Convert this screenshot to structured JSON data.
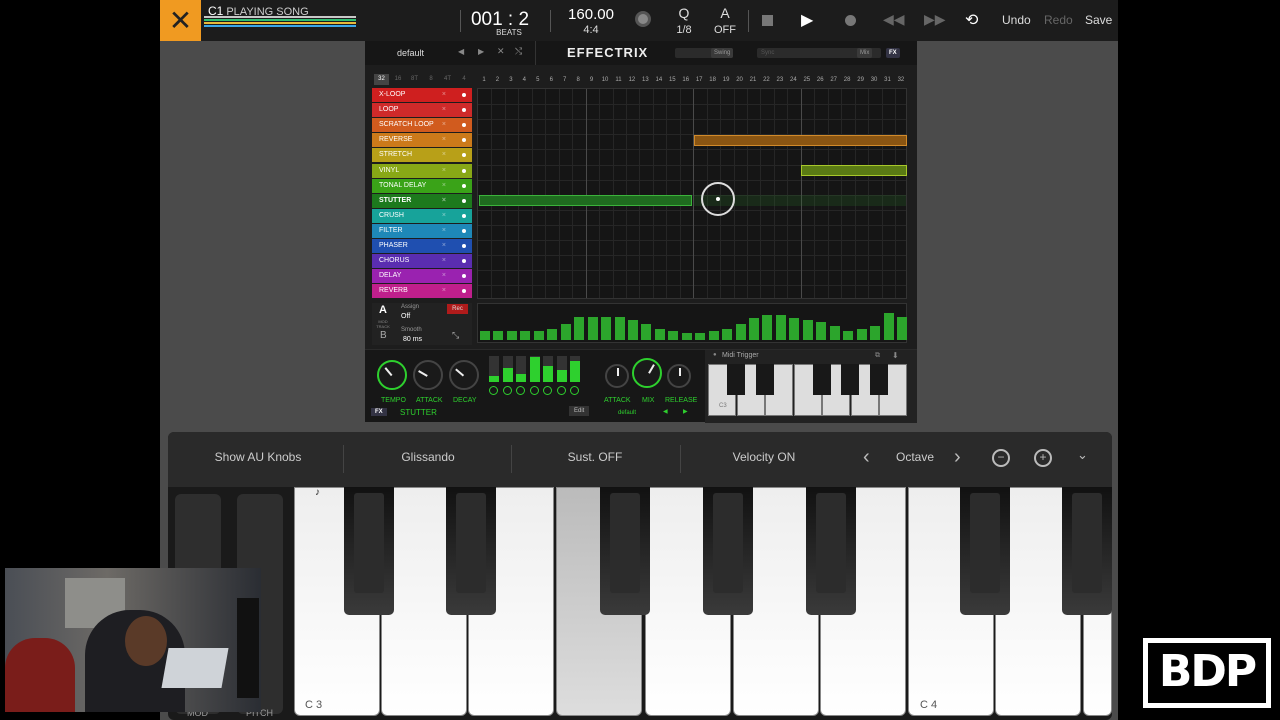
{
  "topbar": {
    "close_icon": "close-icon",
    "track_name": "C1",
    "song_status": "PLAYING SONG",
    "position": "001 : 2",
    "position_unit": "BEATS",
    "tempo": "160.00",
    "time_signature": "4:4",
    "quantize_label": "Q",
    "quantize_value": "1/8",
    "automation_label": "A",
    "automation_value": "OFF",
    "undo_label": "Undo",
    "redo_label": "Redo",
    "save_label": "Save",
    "track_colors": [
      "#c8c8c8",
      "#2fbf72",
      "#e8b93a",
      "#3aa6e8"
    ]
  },
  "plugin": {
    "preset": "default",
    "title": "EFFECTRIX",
    "swing_label": "Swing",
    "sync_label": "Sync",
    "mix_label": "Mix",
    "fx_label": "FX",
    "step_sizes": [
      "32",
      "16",
      "8T",
      "8",
      "4T",
      "4"
    ],
    "effects": [
      {
        "name": "X-LOOP",
        "color": "#cf1f1f"
      },
      {
        "name": "LOOP",
        "color": "#cf2a2a"
      },
      {
        "name": "SCRATCH LOOP",
        "color": "#d15b1e"
      },
      {
        "name": "REVERSE",
        "color": "#cc7a1a"
      },
      {
        "name": "STRETCH",
        "color": "#b8a018"
      },
      {
        "name": "VINYL",
        "color": "#88a816"
      },
      {
        "name": "TONAL DELAY",
        "color": "#3aa318"
      },
      {
        "name": "STUTTER",
        "color": "#1d7a1d"
      },
      {
        "name": "CRUSH",
        "color": "#17a39a"
      },
      {
        "name": "FILTER",
        "color": "#1e88b8"
      },
      {
        "name": "PHASER",
        "color": "#1f4fb0"
      },
      {
        "name": "CHORUS",
        "color": "#5a2db0"
      },
      {
        "name": "DELAY",
        "color": "#9a22b0"
      },
      {
        "name": "REVERB",
        "color": "#c01f8c"
      }
    ],
    "step_numbers": [
      "1",
      "2",
      "3",
      "4",
      "5",
      "6",
      "7",
      "8",
      "9",
      "10",
      "11",
      "12",
      "13",
      "14",
      "15",
      "16",
      "17",
      "18",
      "19",
      "20",
      "21",
      "22",
      "23",
      "24",
      "25",
      "26",
      "27",
      "28",
      "29",
      "30",
      "31",
      "32"
    ],
    "mod_track_a": "A",
    "mod_track_b": "B",
    "mod_track_label": "MOD TRACK",
    "assign_label": "Assign",
    "assign_value": "Off",
    "smooth_label": "Smooth",
    "smooth_value": "80 ms",
    "rec_label": "Rec",
    "mod_values": [
      0.25,
      0.25,
      0.25,
      0.25,
      0.25,
      0.3,
      0.45,
      0.65,
      0.65,
      0.65,
      0.65,
      0.55,
      0.45,
      0.3,
      0.25,
      0.2,
      0.2,
      0.25,
      0.3,
      0.45,
      0.6,
      0.7,
      0.7,
      0.6,
      0.55,
      0.5,
      0.4,
      0.25,
      0.3,
      0.4,
      0.75,
      0.65
    ],
    "knob_tempo": "TEMPO",
    "knob_attack": "ATTACK",
    "knob_decay": "DECAY",
    "knob_attack2": "ATTACK",
    "knob_mix": "MIX",
    "knob_release": "RELEASE",
    "fx_badge": "FX",
    "current_effect": "STUTTER",
    "edit_label": "Edit",
    "default_label": "default",
    "midi_trigger": "Midi Trigger",
    "mini_key_label": "C3",
    "stutter_pattern": [
      0.25,
      0.55,
      0.3,
      0.95,
      0.6,
      0.45,
      0.8
    ]
  },
  "keyboard": {
    "show_au_knobs": "Show AU Knobs",
    "glissando": "Glissando",
    "sustain": "Sust. OFF",
    "velocity": "Velocity ON",
    "octave": "Octave",
    "c3_label": "C 3",
    "c4_label": "C 4",
    "mod_label": "MOD",
    "pitch_label": "PITCH",
    "note_icon": "♪"
  },
  "logo": {
    "text": "BDP"
  }
}
